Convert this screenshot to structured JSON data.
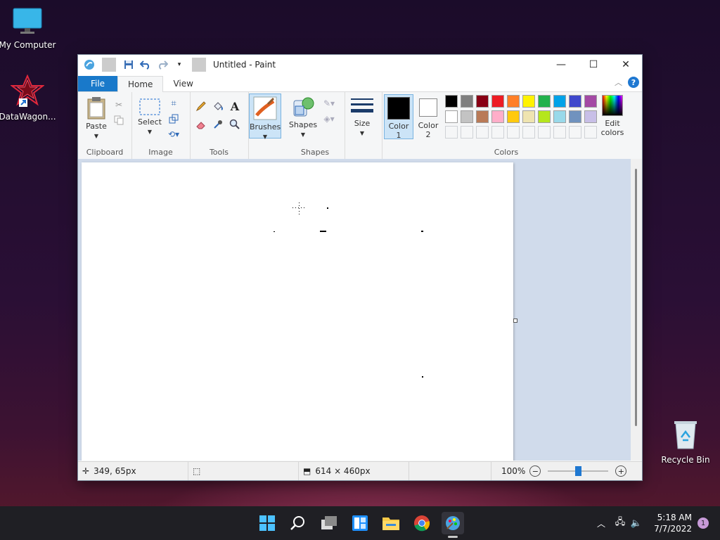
{
  "desktop": {
    "icons": [
      {
        "label": "My Computer"
      },
      {
        "label": "DataWagon..."
      },
      {
        "label": "Recycle Bin"
      }
    ]
  },
  "window": {
    "title": "Untitled - Paint",
    "tabs": [
      {
        "label": "File"
      },
      {
        "label": "Home"
      },
      {
        "label": "View"
      }
    ]
  },
  "ribbon": {
    "clipboard": {
      "group_label": "Clipboard",
      "paste_label": "Paste"
    },
    "image": {
      "group_label": "Image",
      "select_label": "Select"
    },
    "tools": {
      "group_label": "Tools"
    },
    "brushes": {
      "label": "Brushes"
    },
    "shapes": {
      "group_label": "Shapes",
      "shapes_label": "Shapes"
    },
    "size": {
      "label": "Size"
    },
    "colors": {
      "group_label": "Colors",
      "color1_label": "Color",
      "color1_num": "1",
      "color2_label": "Color",
      "color2_num": "2",
      "edit_label": "Edit",
      "edit_label2": "colors",
      "color1": "#000000",
      "color2": "#ffffff",
      "palette_row1": [
        "#000000",
        "#7f7f7f",
        "#880015",
        "#ed1c24",
        "#ff7f27",
        "#fff200",
        "#22b14c",
        "#00a2e8",
        "#3f48cc",
        "#a349a4"
      ],
      "palette_row2": [
        "#ffffff",
        "#c3c3c3",
        "#b97a57",
        "#ffaec9",
        "#ffc90e",
        "#efe4b0",
        "#b5e61d",
        "#99d9ea",
        "#7092be",
        "#c8bfe7"
      ]
    }
  },
  "status": {
    "cursor_pos": "349, 65px",
    "canvas_size": "614 × 460px",
    "zoom": "100%",
    "zoom_level": 0.5
  },
  "tray": {
    "time": "5:18 AM",
    "date": "7/7/2022",
    "notif_count": "1"
  }
}
